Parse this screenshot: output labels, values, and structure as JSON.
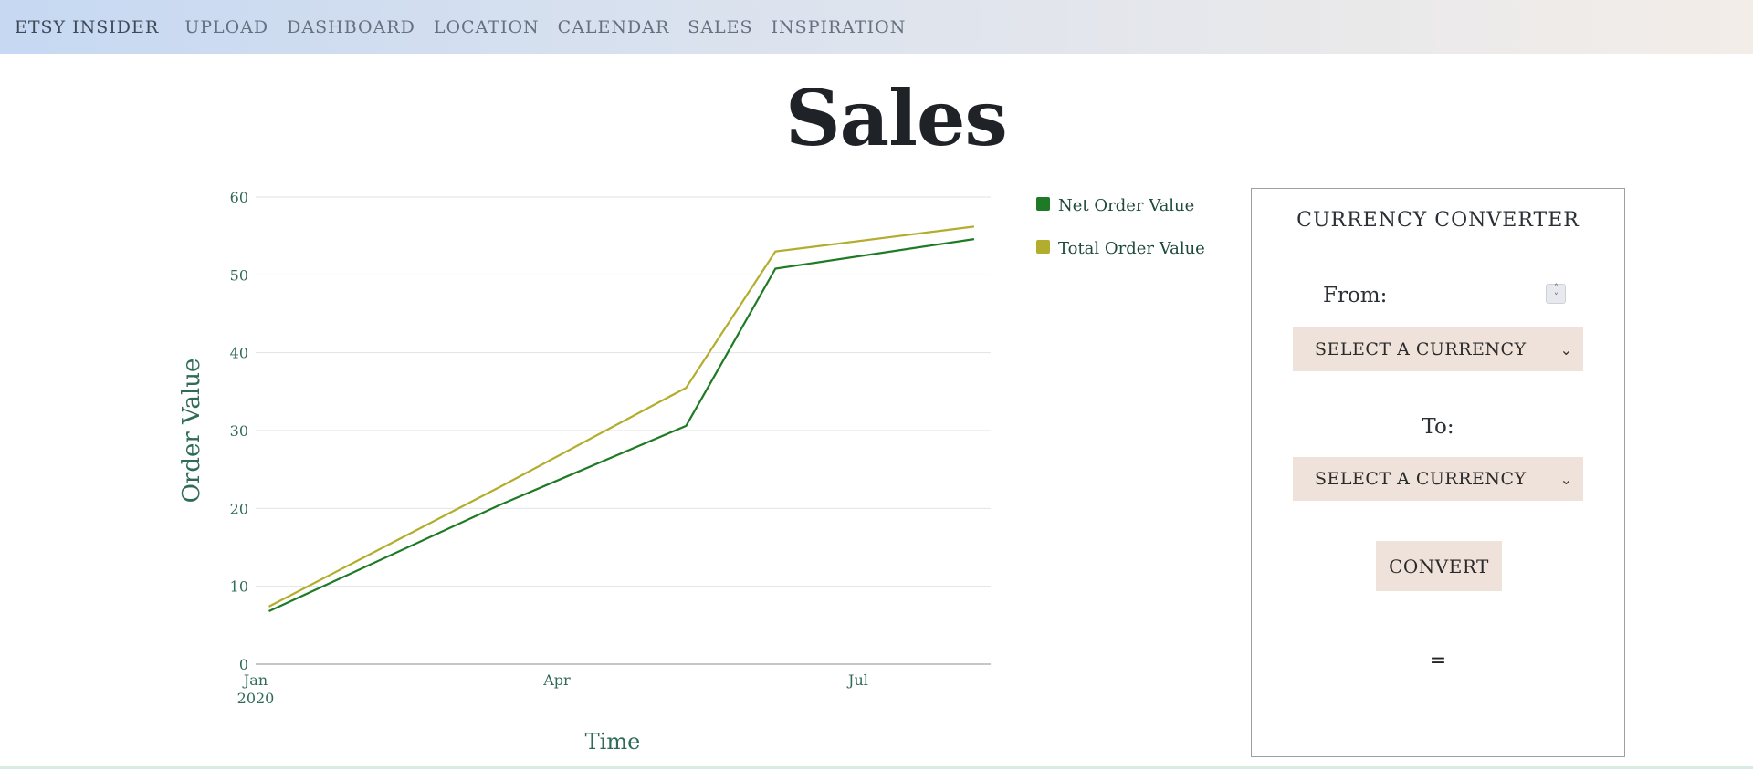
{
  "nav": {
    "brand": "ETSY INSIDER",
    "links": [
      "UPLOAD",
      "DASHBOARD",
      "LOCATION",
      "CALENDAR",
      "SALES",
      "INSPIRATION"
    ]
  },
  "page": {
    "title": "Sales"
  },
  "chart_data": {
    "type": "line",
    "xlabel": "Time",
    "ylabel": "Order Value",
    "ylim": [
      0,
      60
    ],
    "yticks": [
      0,
      10,
      20,
      30,
      40,
      50,
      60
    ],
    "xlim": [
      "2020-01-01",
      "2020-08-10"
    ],
    "xticks": [
      {
        "date": "2020-01-01",
        "label": "Jan",
        "sublabel": "2020"
      },
      {
        "date": "2020-04-01",
        "label": "Apr",
        "sublabel": ""
      },
      {
        "date": "2020-07-01",
        "label": "Jul",
        "sublabel": ""
      }
    ],
    "grid": true,
    "legend_position": "top-right",
    "series": [
      {
        "name": "Net Order Value",
        "color": "#1e7a24",
        "points": [
          {
            "x": "2020-01-05",
            "y": 6.8
          },
          {
            "x": "2020-03-15",
            "y": 20.5
          },
          {
            "x": "2020-05-10",
            "y": 30.6
          },
          {
            "x": "2020-06-06",
            "y": 50.8
          },
          {
            "x": "2020-08-05",
            "y": 54.6
          }
        ]
      },
      {
        "name": "Total Order Value",
        "color": "#b3ad2e",
        "points": [
          {
            "x": "2020-01-05",
            "y": 7.4
          },
          {
            "x": "2020-03-15",
            "y": 22.8
          },
          {
            "x": "2020-05-10",
            "y": 35.5
          },
          {
            "x": "2020-06-06",
            "y": 53.0
          },
          {
            "x": "2020-08-05",
            "y": 56.2
          }
        ]
      }
    ],
    "axis_text_color": "#2f6b55",
    "grid_color": "#e2e2e2"
  },
  "converter": {
    "title": "CURRENCY CONVERTER",
    "from_label": "From:",
    "from_value": "",
    "from_select": "SELECT A CURRENCY",
    "to_label": "To:",
    "to_select": "SELECT A CURRENCY",
    "convert_label": "CONVERT",
    "result": "="
  }
}
